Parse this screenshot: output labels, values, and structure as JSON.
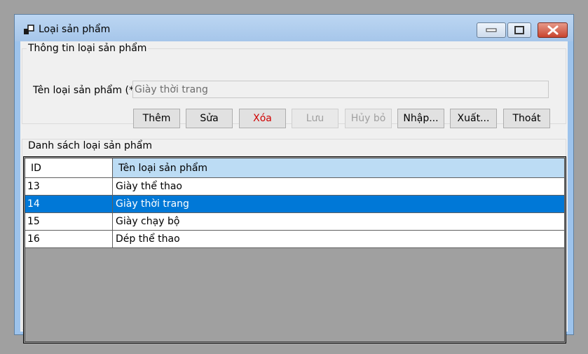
{
  "window": {
    "title": "Loại sản phẩm"
  },
  "info_group": {
    "title": "Thông tin loại sản phẩm",
    "name_label": "Tên loại sản phẩm (*)",
    "name_value": "Giày thời trang"
  },
  "buttons": {
    "add": "Thêm",
    "edit": "Sửa",
    "delete": "Xóa",
    "save": "Lưu",
    "cancel": "Hủy bỏ",
    "import": "Nhập...",
    "export": "Xuất...",
    "exit": "Thoát"
  },
  "list_group": {
    "title": "Danh sách loại sản phẩm"
  },
  "table": {
    "columns": [
      "ID",
      "Tên loại sản phẩm"
    ],
    "rows": [
      {
        "id": "13",
        "name": "Giày thể thao"
      },
      {
        "id": "14",
        "name": "Giày thời trang"
      },
      {
        "id": "15",
        "name": "Giày chạy bộ"
      },
      {
        "id": "16",
        "name": "Dép thể thao"
      }
    ],
    "selected_index": 1
  },
  "colors": {
    "selection": "#0078d7",
    "header_highlight": "#bcdcf4",
    "delete_text": "#d00000"
  }
}
